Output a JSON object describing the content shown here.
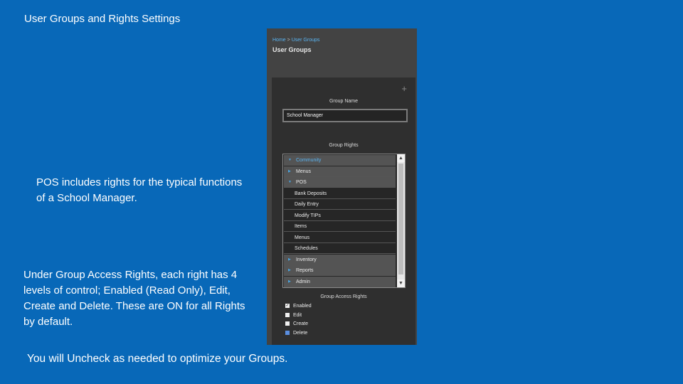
{
  "slide": {
    "title": "User Groups and Rights Settings",
    "note_pos": "POS includes rights for the typical functions of a School Manager.",
    "note_access": "Under Group Access Rights, each right has 4 levels of control; Enabled (Read Only), Edit, Create and Delete. These are ON for all Rights by default.",
    "note_uncheck": "You will Uncheck as needed to optimize your Groups."
  },
  "app": {
    "breadcrumb": {
      "home": "Home",
      "separator": ">",
      "current": "User Groups"
    },
    "page_title": "User Groups",
    "add_icon": "plus-icon",
    "group_name_label": "Group Name",
    "group_name_value": "School Manager",
    "group_rights_label": "Group Rights",
    "rights": [
      {
        "label": "Community",
        "kind": "group",
        "state": "expanded",
        "active": true
      },
      {
        "label": "Menus",
        "kind": "group",
        "state": "collapsed"
      },
      {
        "label": "POS",
        "kind": "group",
        "state": "expanded"
      },
      {
        "label": "Bank Deposits",
        "kind": "child"
      },
      {
        "label": "Daily Entry",
        "kind": "child"
      },
      {
        "label": "Modify TIPs",
        "kind": "child"
      },
      {
        "label": "Items",
        "kind": "child"
      },
      {
        "label": "Menus",
        "kind": "child"
      },
      {
        "label": "Schedules",
        "kind": "child"
      },
      {
        "label": "Inventory",
        "kind": "group",
        "state": "collapsed"
      },
      {
        "label": "Reports",
        "kind": "group",
        "state": "collapsed"
      },
      {
        "label": "Admin",
        "kind": "group",
        "state": "collapsed"
      }
    ],
    "access_label": "Group Access Rights",
    "access_rights": [
      {
        "label": "Enabled",
        "checked": true
      },
      {
        "label": "Edit",
        "checked": false
      },
      {
        "label": "Create",
        "checked": false
      },
      {
        "label": "Delete",
        "checked": false,
        "highlight": true
      }
    ]
  }
}
